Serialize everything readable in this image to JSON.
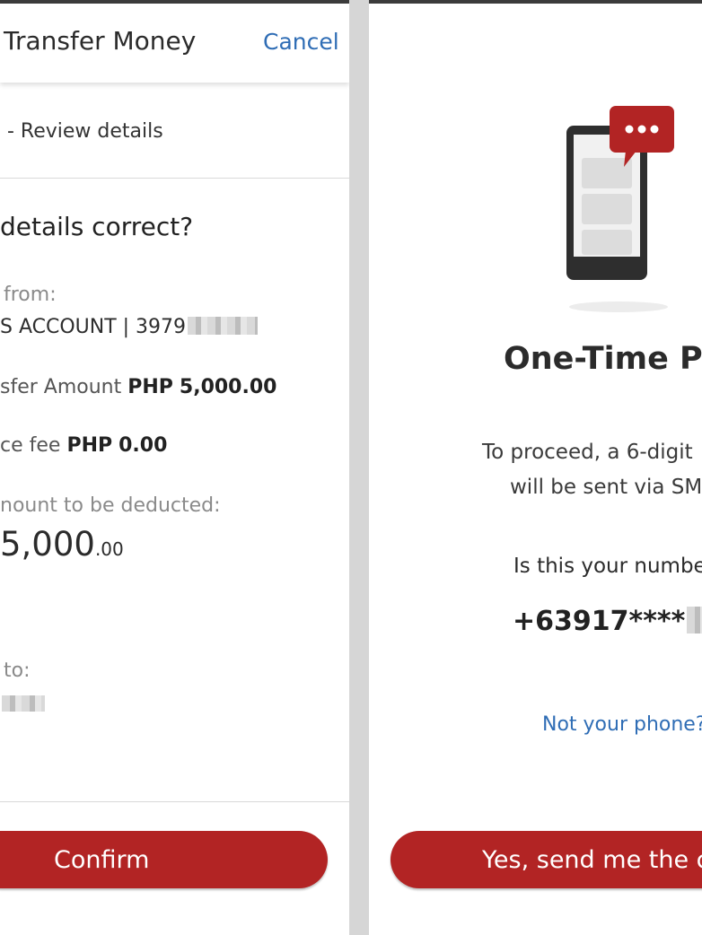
{
  "left": {
    "header": {
      "title": "Transfer Money",
      "cancel": "Cancel"
    },
    "step": "- Review details",
    "question": "details correct?",
    "from_label": "from:",
    "account": "S ACCOUNT | 3979",
    "transfer_label": "sfer Amount",
    "transfer_currency": "PHP",
    "transfer_amount": "5,000.00",
    "fee_label": "ce fee",
    "fee_currency": "PHP",
    "fee_amount": "0.00",
    "deduct_label": "nount to be deducted:",
    "deduct_main": "5,000",
    "deduct_cents": ".00",
    "to_label": "to:",
    "confirm": "Confirm"
  },
  "right": {
    "title": "One-Time PI",
    "msg_line1": "To proceed, a 6-digit",
    "msg_line2": "will be sent via SM",
    "question": "Is this your numbe",
    "number": "+63917****",
    "not_phone": "Not your phone?",
    "send_button": "Yes, send me the c"
  },
  "colors": {
    "accent_red": "#b22424",
    "link_blue": "#2f6db5",
    "gutter": "#d6d6d6"
  },
  "icons": [
    "phone-sms-icon",
    "chat-bubble-icon"
  ]
}
